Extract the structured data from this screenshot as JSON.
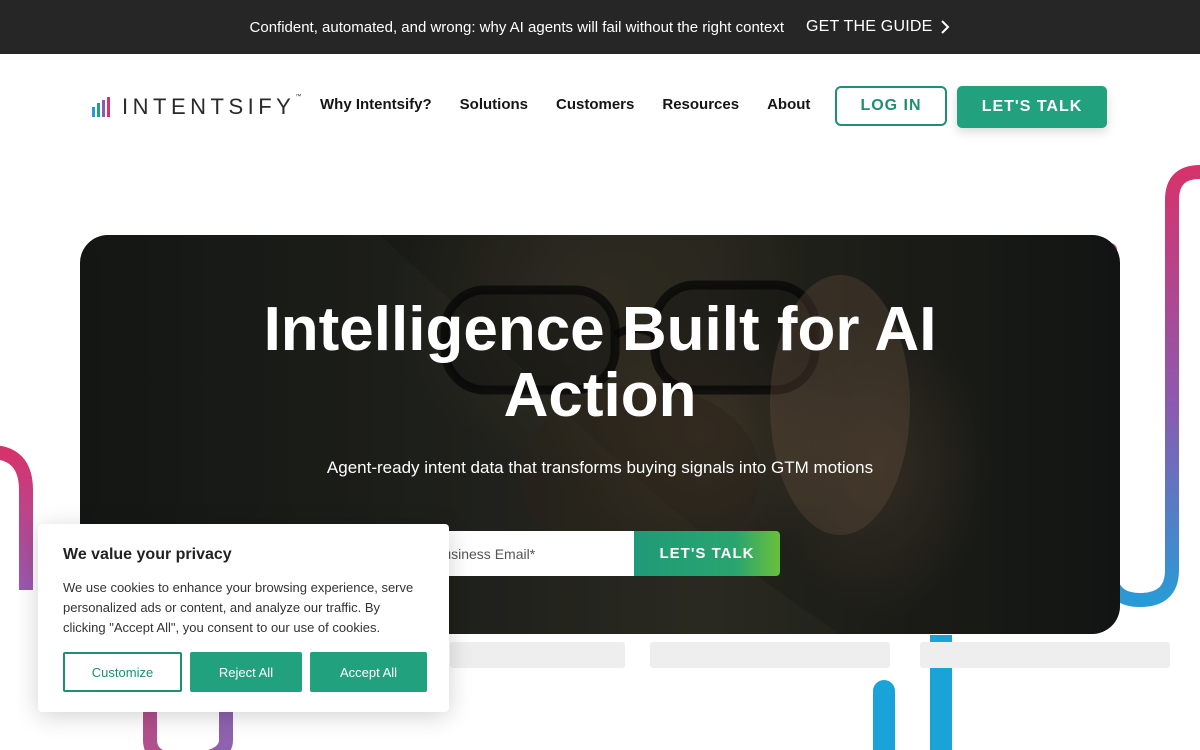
{
  "announcement": {
    "text": "Confident, automated, and wrong: why AI agents will fail without the right context",
    "cta": "GET THE GUIDE"
  },
  "header": {
    "logo_text": "INTENTSIFY",
    "logo_mark": "™",
    "nav": [
      "Why Intentsify?",
      "Solutions",
      "Customers",
      "Resources",
      "About"
    ],
    "login": "LOG IN",
    "talk": "LET'S TALK"
  },
  "hero": {
    "title_line1": "Intelligence Built for AI",
    "title_line2": "Action",
    "subtitle": "Agent-ready intent data that transforms buying signals into GTM motions",
    "email_placeholder": "Business Email*",
    "submit": "LET'S TALK"
  },
  "cookie": {
    "title": "We value your privacy",
    "body": "We use cookies to enhance your browsing experience, serve personalized ads or content, and analyze our traffic. By clicking \"Accept All\", you consent to our use of cookies.",
    "customize": "Customize",
    "reject": "Reject All",
    "accept": "Accept All"
  },
  "colors": {
    "brand_green": "#22a17f",
    "dark_bar": "#262626",
    "loop_magenta": "#d6336c",
    "loop_blue": "#1aa3d9"
  },
  "icons": {
    "announcement_arrow": "chevron-right-icon",
    "logo": "signal-bars-icon"
  }
}
